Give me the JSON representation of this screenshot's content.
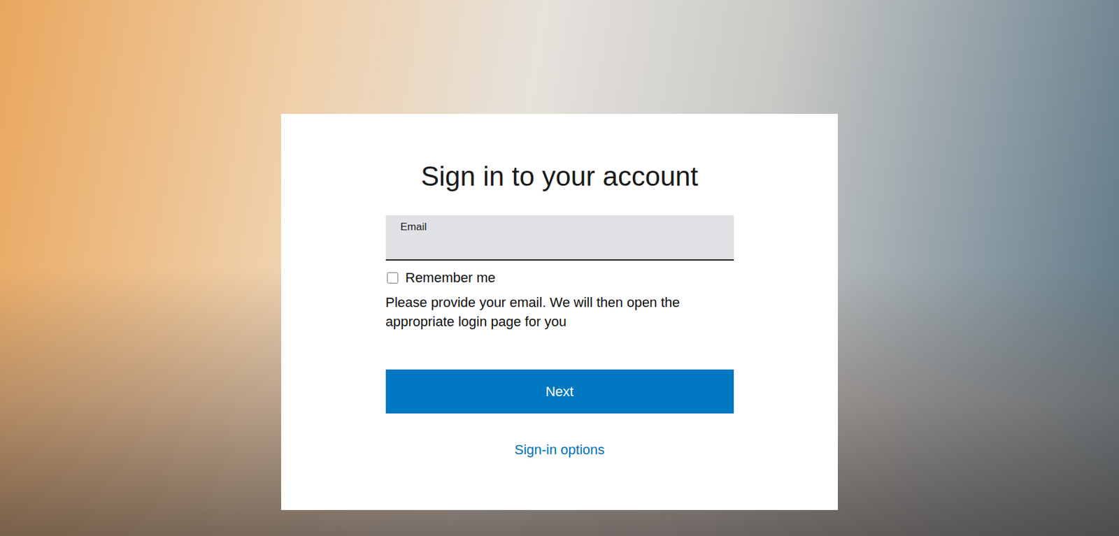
{
  "page": {
    "title": "Sign in to your account"
  },
  "email_field": {
    "label": "Email",
    "value": ""
  },
  "remember_me": {
    "label": "Remember me",
    "checked": false
  },
  "help_text": "Please provide your email. We will then open the appropriate login page for you",
  "buttons": [
    {
      "label": "Next"
    }
  ],
  "links": [
    {
      "label": "Sign-in options"
    }
  ]
}
